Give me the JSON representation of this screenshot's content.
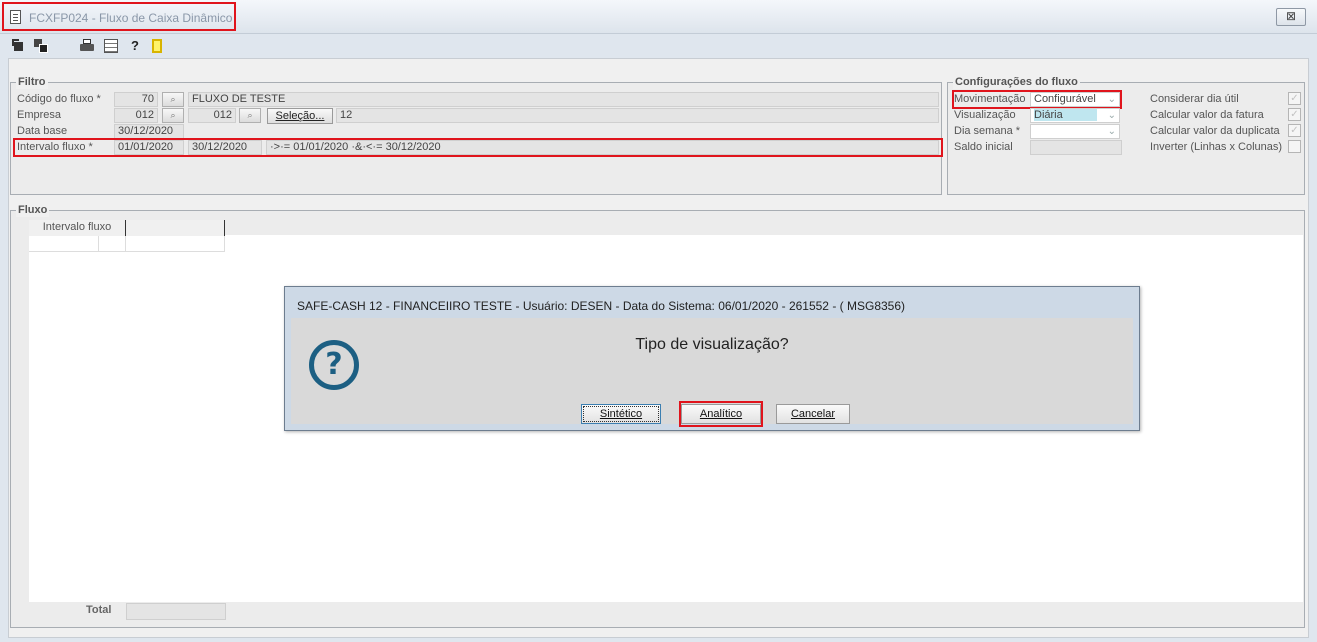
{
  "window": {
    "title": "FCXFP024 - Fluxo de Caixa Dinâmico",
    "close_glyph": "⊠"
  },
  "toolbar": {
    "icons": [
      "export-icon",
      "copy-icon",
      "print-icon",
      "table-icon",
      "help-icon",
      "exit-icon"
    ]
  },
  "filtro": {
    "title": "Filtro",
    "codigo_label": "Código do fluxo *",
    "codigo_value": "70",
    "codigo_desc": "FLUXO DE TESTE",
    "empresa_label": "Empresa",
    "empresa_value": "012",
    "empresa_value2": "012",
    "selecao_label": "Seleção...",
    "selecao_value": "12",
    "database_label": "Data base",
    "database_value": "30/12/2020",
    "intervalo_label": "Intervalo fluxo *",
    "intervalo_from": "01/01/2020",
    "intervalo_to": "30/12/2020",
    "intervalo_expr": "·>·= 01/01/2020 ·&·<·= 30/12/2020"
  },
  "config": {
    "title": "Configurações do fluxo",
    "movimentacao_label": "Movimentação",
    "movimentacao_value": "Configurável",
    "visualizacao_label": "Visualização",
    "visualizacao_value": "Diária",
    "diasemana_label": "Dia semana *",
    "diasemana_value": "",
    "saldo_label": "Saldo inicial",
    "saldo_value": "",
    "considerar_label": "Considerar dia útil",
    "calc_fatura_label": "Calcular valor da fatura",
    "calc_duplicata_label": "Calcular valor da duplicata",
    "inverter_label": "Inverter (Linhas x Colunas)"
  },
  "fluxo": {
    "title": "Fluxo",
    "col_intervalo": "Intervalo fluxo",
    "col_blank": "",
    "total_label": "Total",
    "total_value": ""
  },
  "dialog": {
    "title": "SAFE-CASH 12 - FINANCEIIRO TESTE - Usuário: DESEN - Data do Sistema: 06/01/2020 - 261552 - ( MSG8356)",
    "message": "Tipo de visualização?",
    "icon_glyph": "?",
    "btn_sintetico": "Sintético",
    "btn_analitico": "Analítico",
    "btn_cancelar": "Cancelar"
  },
  "colors": {
    "highlight": "#e0141c",
    "accent_blue": "#1c5f83",
    "selected_bg": "#bfe6ef"
  }
}
